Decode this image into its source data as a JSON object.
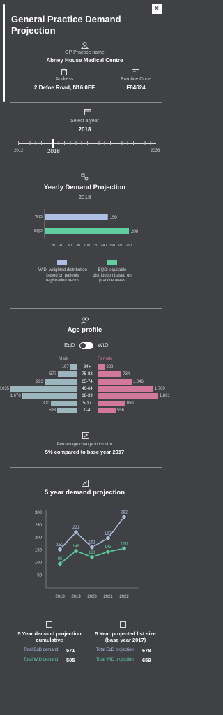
{
  "header": {
    "title": "General Practice Demand Projection",
    "close_label": "×"
  },
  "practice": {
    "name_label": "GP Practice name",
    "name": "Abney House Medical Centre",
    "address_label": "Address",
    "address": "2 Defoe Road, N16 0EF",
    "code_label": "Practice Code",
    "code": "F84624"
  },
  "year_selector": {
    "label": "Select a year",
    "selected": "2018",
    "min": "2012",
    "max": "2036",
    "slider_value_fraction": 0.25
  },
  "yearly_demand": {
    "title": "Yearly Demand Projection",
    "year": "2018",
    "legend_wtd": "WtD: weighted distribution based on patients registration trends",
    "legend_eqd": "EQD: equitable distribution based on practice areas"
  },
  "age_profile": {
    "title": "Age profile",
    "toggle_left": "EqD",
    "toggle_right": "WtD",
    "male_label": "Male",
    "female_label": "Female",
    "rows": [
      {
        "cat": "84+",
        "male": 197,
        "female": 222
      },
      {
        "cat": "75-83",
        "male": 577,
        "female": 734
      },
      {
        "cat": "65-74",
        "male": 993,
        "female": 1046
      },
      {
        "cat": "40-64",
        "male": 2035,
        "female": 1709
      },
      {
        "cat": "18-39",
        "male": 1678,
        "female": 1861
      },
      {
        "cat": "5-17",
        "male": 800,
        "female": 850
      },
      {
        "cat": "0-4",
        "male": 598,
        "female": 556
      }
    ],
    "male_labels": [
      "197",
      "577",
      "993",
      "2,035",
      "1,678",
      "800",
      "598"
    ],
    "female_labels": [
      "222",
      "734",
      "1,046",
      "1,709",
      "1,861",
      "850",
      "556"
    ],
    "pct_label": "Percentage change in list size",
    "pct_value": "5% compared to base year 2017"
  },
  "five_year": {
    "title": "5 year demand projection",
    "cumulative_title": "5 Year demand projection cumulative",
    "eqd_label": "Total EqD demand:",
    "eqd_value": "571",
    "wtd_label": "Total WtD demand:",
    "wtd_value": "505",
    "list_title": "5 Year projected list size (base year 2017)",
    "eqd_proj_label": "Total EqD projection:",
    "eqd_proj_value": "678",
    "wtd_proj_label": "Total WtD projection:",
    "wtd_proj_value": "659"
  },
  "colors": {
    "background": "#3f4145",
    "wtd": "#aebfe4",
    "eqd": "#5fcf9f",
    "male": "#9bb6bd",
    "female": "#d2789a"
  },
  "chart_data": [
    {
      "type": "bar",
      "orientation": "horizontal",
      "categories": [
        "WtD",
        "EQD"
      ],
      "values": [
        150,
        200
      ],
      "xticks": [
        "20",
        "40",
        "60",
        "80",
        "100",
        "120",
        "140",
        "160",
        "180",
        "200"
      ],
      "xlim": [
        0,
        200
      ]
    },
    {
      "type": "line",
      "x": [
        "2018",
        "2019",
        "2020",
        "2021",
        "2022"
      ],
      "series": [
        {
          "name": "WtD",
          "values": [
            152,
            221,
            161,
            197,
            282
          ]
        },
        {
          "name": "EqD",
          "values": [
            95,
            146,
            121,
            143,
            156
          ]
        }
      ],
      "yticks": [
        "50",
        "100",
        "150",
        "200",
        "250",
        "300"
      ],
      "ylim": [
        20,
        300
      ]
    }
  ]
}
